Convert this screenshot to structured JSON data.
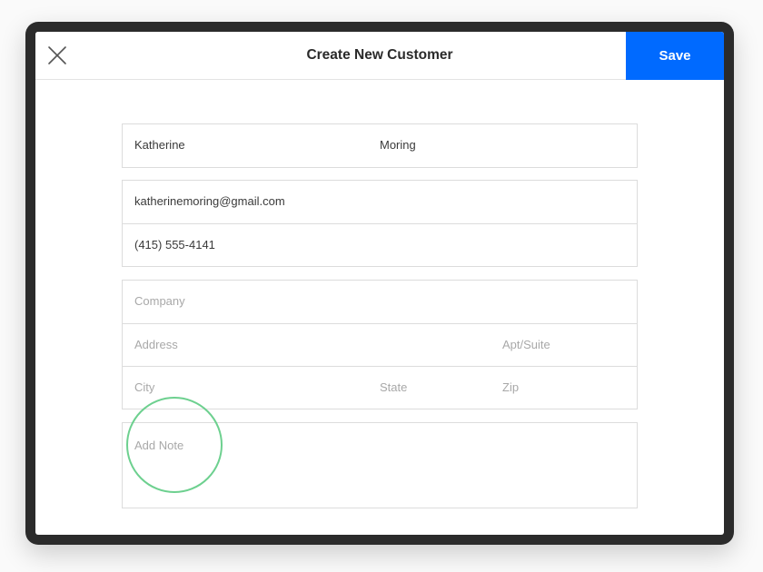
{
  "header": {
    "title": "Create New Customer",
    "save_label": "Save",
    "close_icon": "close-icon",
    "accent_color": "#006aff"
  },
  "form": {
    "first_name": "Katherine",
    "last_name": "Moring",
    "email": "katherinemoring@gmail.com",
    "phone": "(415) 555-4141",
    "company_placeholder": "Company",
    "address_placeholder": "Address",
    "apt_placeholder": "Apt/Suite",
    "city_placeholder": "City",
    "state_placeholder": "State",
    "zip_placeholder": "Zip",
    "note_placeholder": "Add Note"
  },
  "annotation": {
    "highlight_color": "#6dd08f"
  }
}
